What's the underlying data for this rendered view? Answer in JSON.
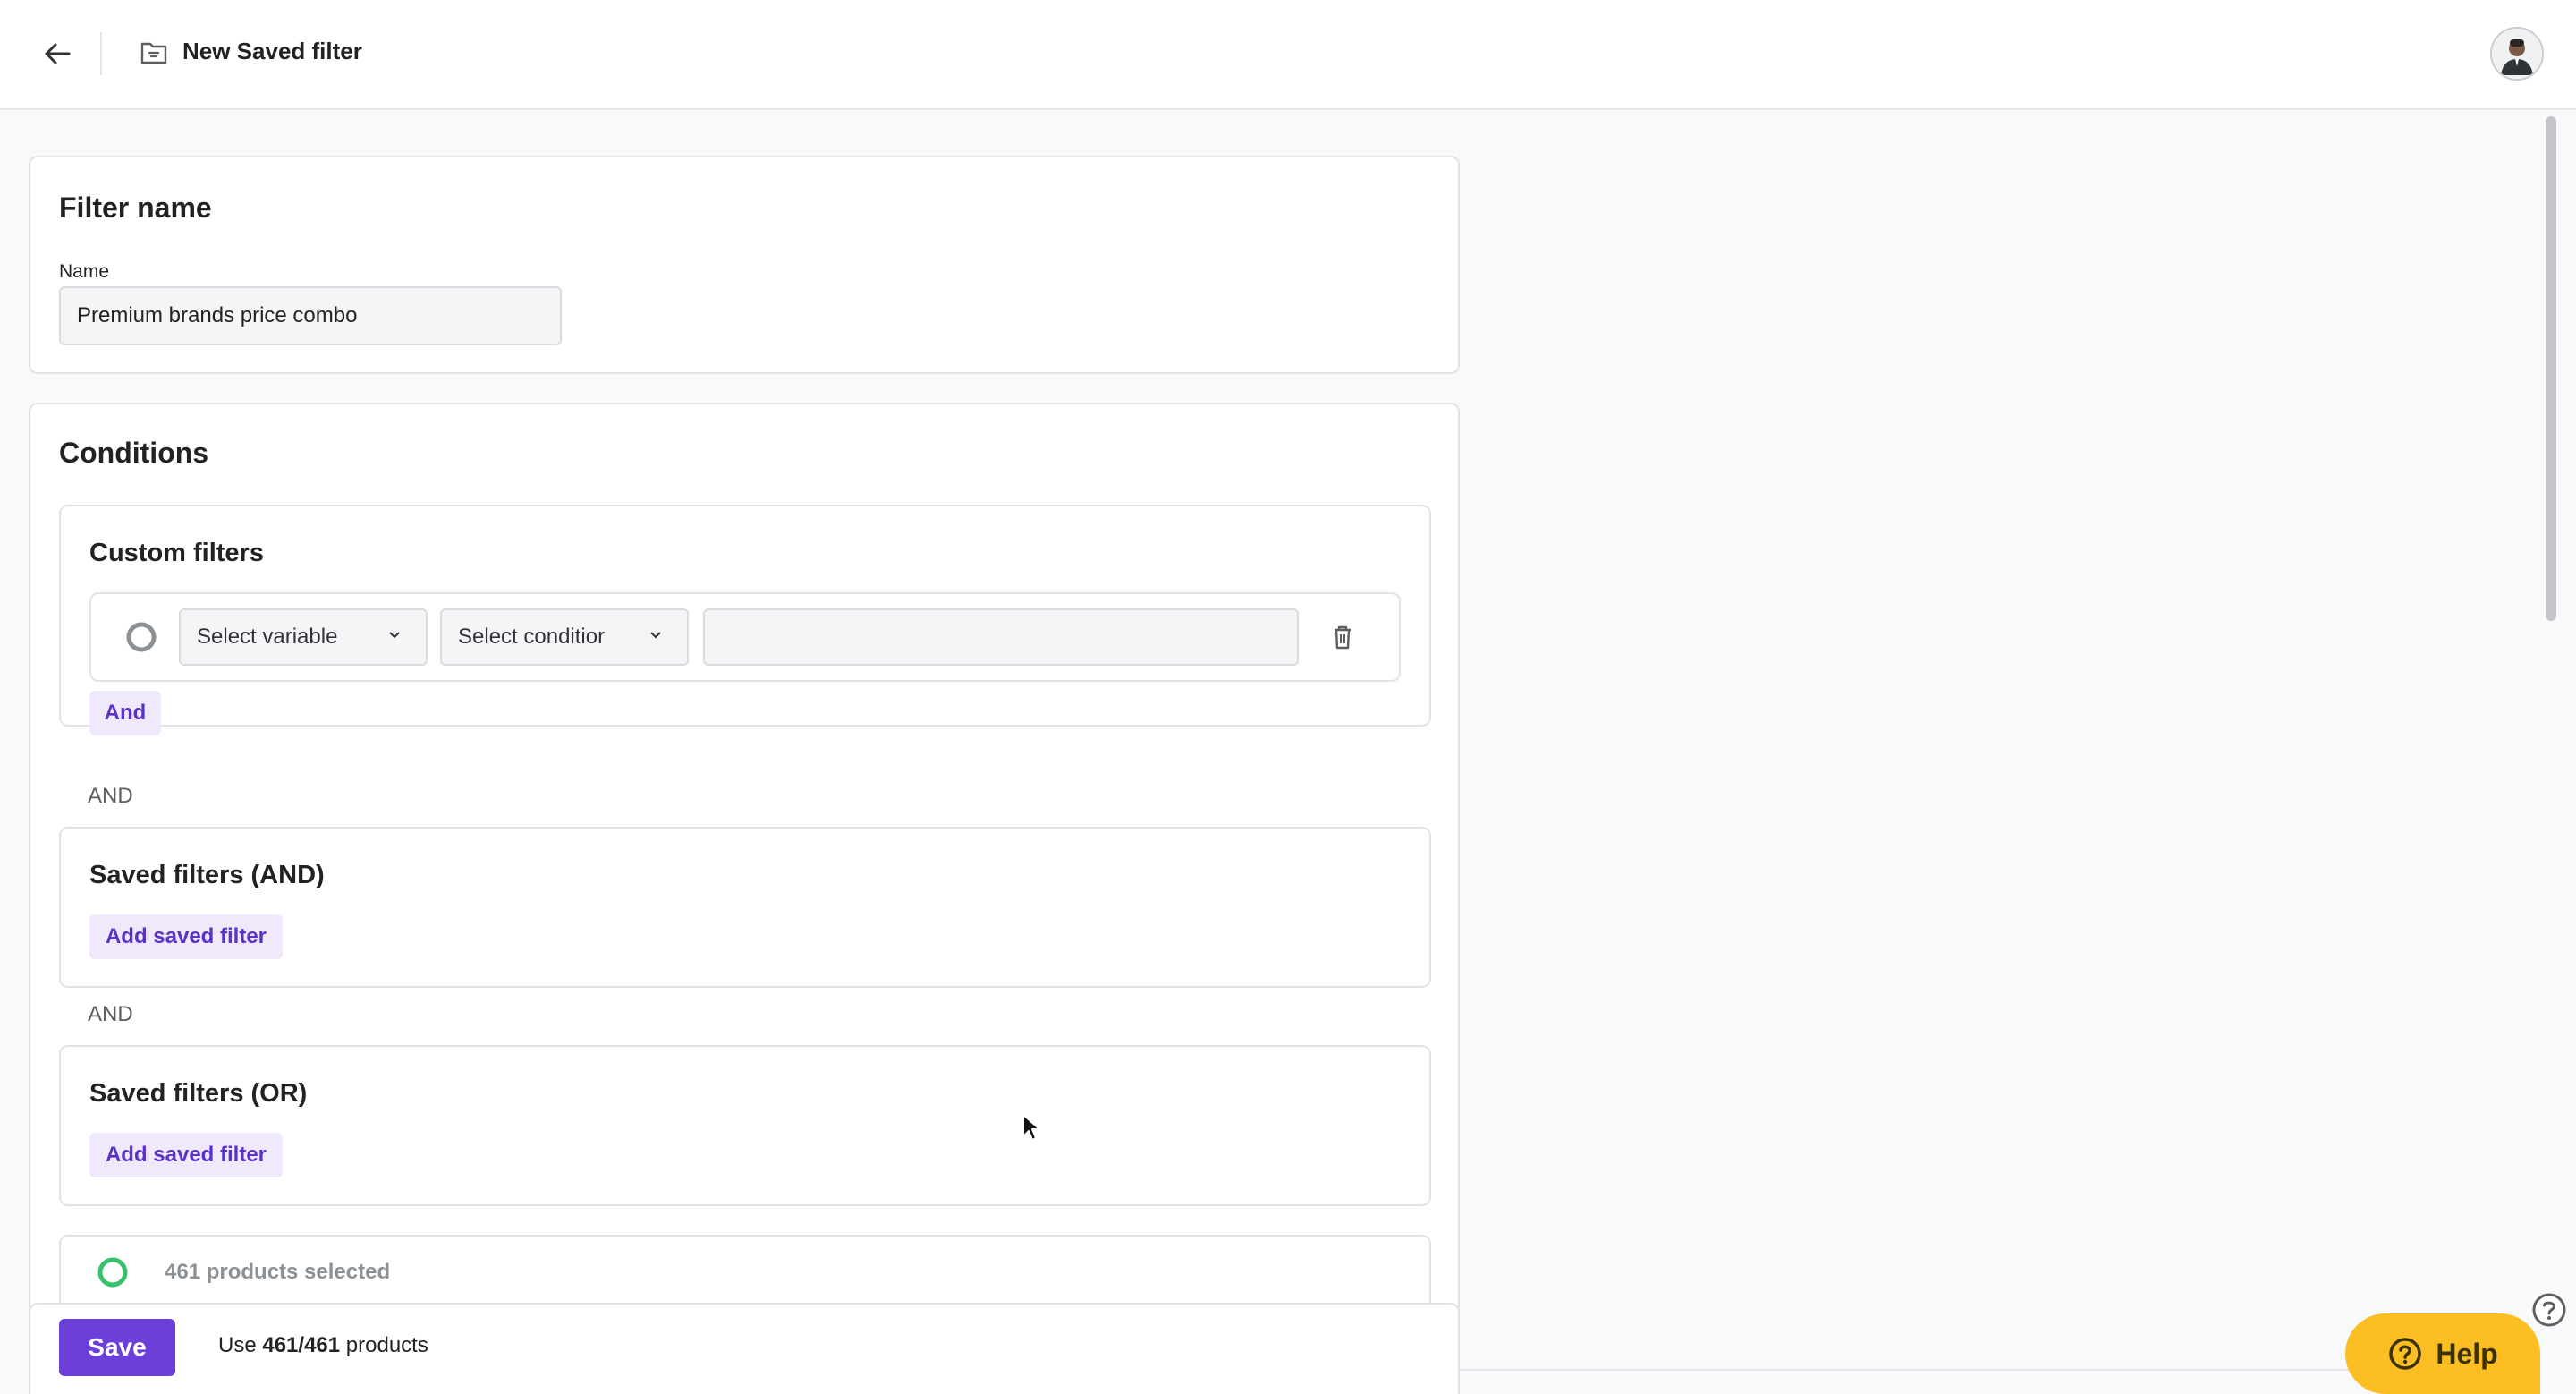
{
  "header": {
    "back_icon": "arrow-left-icon",
    "folder_icon": "folder-icon",
    "title": "New Saved filter",
    "avatar_icon": "user-avatar"
  },
  "filter_name": {
    "title": "Filter name",
    "name_label": "Name",
    "name_value": "Premium brands price combo"
  },
  "conditions": {
    "title": "Conditions",
    "custom_filters": {
      "title": "Custom filters",
      "variable_placeholder": "Select variable",
      "condition_placeholder": "Select conditior",
      "value": "",
      "and_button": "And"
    },
    "and_separator_1": "AND",
    "saved_and": {
      "title": "Saved filters (AND)",
      "add_button": "Add saved filter"
    },
    "and_separator_2": "AND",
    "saved_or": {
      "title": "Saved filters (OR)",
      "add_button": "Add saved filter"
    },
    "products_selected": "461 products selected"
  },
  "footer": {
    "save_label": "Save",
    "usage_prefix": "Use ",
    "usage_count": "461/461",
    "usage_suffix": " products"
  },
  "help": {
    "label": "Help"
  },
  "colors": {
    "primary": "#6b3fd8",
    "pill_bg": "#efe9fb",
    "success": "#36c26b",
    "help": "#fbbf24"
  }
}
